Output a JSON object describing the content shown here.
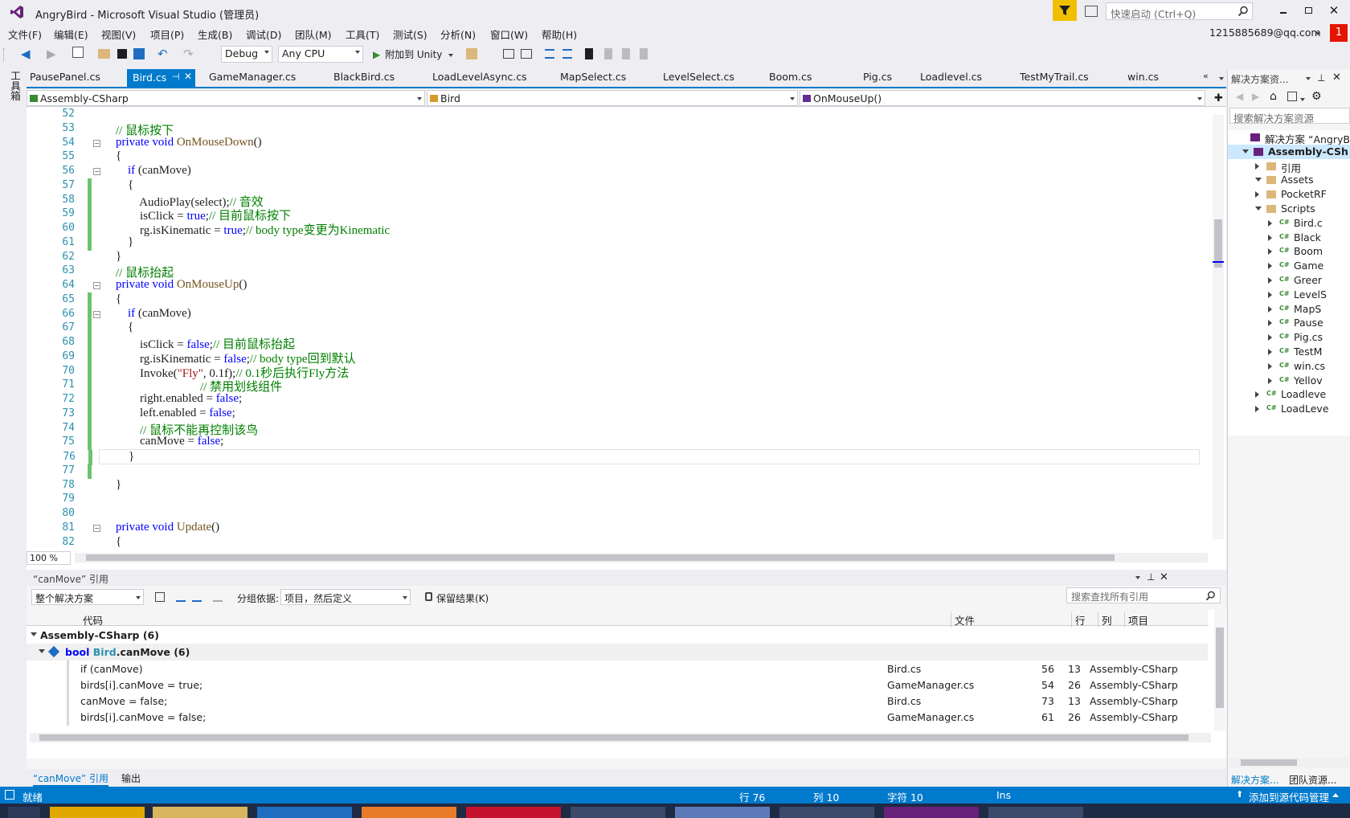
{
  "window": {
    "title": "AngryBird - Microsoft Visual Studio (管理员)",
    "quick_launch_placeholder": "快速启动 (Ctrl+Q)",
    "account": "1215885689@qq.com",
    "notification_count": "1"
  },
  "menu": [
    "文件(F)",
    "编辑(E)",
    "视图(V)",
    "项目(P)",
    "生成(B)",
    "调试(D)",
    "团队(M)",
    "工具(T)",
    "测试(S)",
    "分析(N)",
    "窗口(W)",
    "帮助(H)"
  ],
  "toolbar": {
    "config": "Debug",
    "platform": "Any CPU",
    "attach": "附加到 Unity"
  },
  "toolbox_label": "工具箱",
  "tabs": [
    "PausePanel.cs",
    "Bird.cs",
    "GameManager.cs",
    "BlackBird.cs",
    "LoadLevelAsync.cs",
    "MapSelect.cs",
    "LevelSelect.cs",
    "Boom.cs",
    "Pig.cs",
    "Loadlevel.cs",
    "TestMyTrail.cs",
    "win.cs"
  ],
  "navbar": {
    "project": "Assembly-CSharp",
    "class": "Bird",
    "member": "OnMouseUp()"
  },
  "code_lines": [
    {
      "n": "52",
      "t": ""
    },
    {
      "n": "53",
      "t": "    // 鼠标按下"
    },
    {
      "n": "54",
      "t": "    private void OnMouseDown()"
    },
    {
      "n": "55",
      "t": "    {"
    },
    {
      "n": "56",
      "t": "        if (canMove)"
    },
    {
      "n": "57",
      "t": "        {"
    },
    {
      "n": "58",
      "t": "            AudioPlay(select);// 音效"
    },
    {
      "n": "59",
      "t": "            isClick = true;// 目前鼠标按下"
    },
    {
      "n": "60",
      "t": "            rg.isKinematic = true;// body type变更为Kinematic"
    },
    {
      "n": "61",
      "t": "        }"
    },
    {
      "n": "62",
      "t": "    }"
    },
    {
      "n": "63",
      "t": "    // 鼠标抬起"
    },
    {
      "n": "64",
      "t": "    private void OnMouseUp()"
    },
    {
      "n": "65",
      "t": "    {"
    },
    {
      "n": "66",
      "t": "        if (canMove)"
    },
    {
      "n": "67",
      "t": "        {"
    },
    {
      "n": "68",
      "t": "            isClick = false;// 目前鼠标抬起"
    },
    {
      "n": "69",
      "t": "            rg.isKinematic = false;// body type回到默认"
    },
    {
      "n": "70",
      "t": "            Invoke(\"Fly\", 0.1f);// 0.1秒后执行Fly方法"
    },
    {
      "n": "71",
      "t": "                                // 禁用划线组件"
    },
    {
      "n": "72",
      "t": "            right.enabled = false;"
    },
    {
      "n": "73",
      "t": "            left.enabled = false;"
    },
    {
      "n": "74",
      "t": "            // 鼠标不能再控制该鸟"
    },
    {
      "n": "75",
      "t": "            canMove = false;"
    },
    {
      "n": "76",
      "t": "        }"
    },
    {
      "n": "77",
      "t": ""
    },
    {
      "n": "78",
      "t": "    }"
    },
    {
      "n": "79",
      "t": ""
    },
    {
      "n": "80",
      "t": ""
    },
    {
      "n": "81",
      "t": "    private void Update()"
    },
    {
      "n": "82",
      "t": "    {"
    }
  ],
  "zoom": "100 %",
  "solution_explorer": {
    "title": "解决方案资... ",
    "search_placeholder": "搜索解决方案资源",
    "items": [
      {
        "label": "解决方案 “AngryBi",
        "depth": 0,
        "expand": "none"
      },
      {
        "label": "Assembly-CSh",
        "depth": 1,
        "expand": "open"
      },
      {
        "label": "引用",
        "depth": 2,
        "expand": "closed"
      },
      {
        "label": "Assets",
        "depth": 2,
        "expand": "open"
      },
      {
        "label": "PocketRF",
        "depth": 3,
        "expand": "closed"
      },
      {
        "label": "Scripts",
        "depth": 3,
        "expand": "open"
      },
      {
        "label": "Bird.c",
        "depth": 4,
        "expand": "closed"
      },
      {
        "label": "Black",
        "depth": 4,
        "expand": "closed"
      },
      {
        "label": "Boom",
        "depth": 4,
        "expand": "closed"
      },
      {
        "label": "Game",
        "depth": 4,
        "expand": "closed"
      },
      {
        "label": "Greer",
        "depth": 4,
        "expand": "closed"
      },
      {
        "label": "LevelS",
        "depth": 4,
        "expand": "closed"
      },
      {
        "label": "MapS",
        "depth": 4,
        "expand": "closed"
      },
      {
        "label": "Pause",
        "depth": 4,
        "expand": "closed"
      },
      {
        "label": "Pig.cs",
        "depth": 4,
        "expand": "closed"
      },
      {
        "label": "TestM",
        "depth": 4,
        "expand": "closed"
      },
      {
        "label": "win.cs",
        "depth": 4,
        "expand": "closed"
      },
      {
        "label": "Yellov",
        "depth": 4,
        "expand": "closed"
      },
      {
        "label": "Loadleve",
        "depth": 3,
        "expand": "closed"
      },
      {
        "label": "LoadLeve",
        "depth": 3,
        "expand": "closed"
      }
    ],
    "bottom_tabs": [
      "解决方案...",
      "团队资源..."
    ]
  },
  "references": {
    "title": "“canMove” 引用",
    "scope": "整个解决方案",
    "group_by_label": "分组依据:",
    "group_by": "项目，然后定义",
    "keep_results": "保留结果(K)",
    "search_placeholder": "搜索查找所有引用",
    "columns": {
      "code": "代码",
      "file": "文件",
      "line": "行",
      "col": "列",
      "project": "项目"
    },
    "group1": "Assembly-CSharp (6)",
    "group2_kw": "bool",
    "group2_cls": "Bird",
    "group2_rest": ".canMove  (6)",
    "rows": [
      {
        "code": "if (canMove)",
        "file": "Bird.cs",
        "line": "56",
        "col": "13",
        "project": "Assembly-CSharp"
      },
      {
        "code": "birds[i].canMove = true;",
        "file": "GameManager.cs",
        "line": "54",
        "col": "26",
        "project": "Assembly-CSharp"
      },
      {
        "code": "canMove = false;",
        "file": "Bird.cs",
        "line": "73",
        "col": "13",
        "project": "Assembly-CSharp"
      },
      {
        "code": "birds[i].canMove = false;",
        "file": "GameManager.cs",
        "line": "61",
        "col": "26",
        "project": "Assembly-CSharp"
      }
    ],
    "bottom_tabs": [
      "“canMove” 引用",
      "输出"
    ]
  },
  "status": {
    "ready": "就绪",
    "line": "行 76",
    "col": "列 10",
    "char": "字符 10",
    "ins": "Ins",
    "source_control": "添加到源代码管理"
  }
}
